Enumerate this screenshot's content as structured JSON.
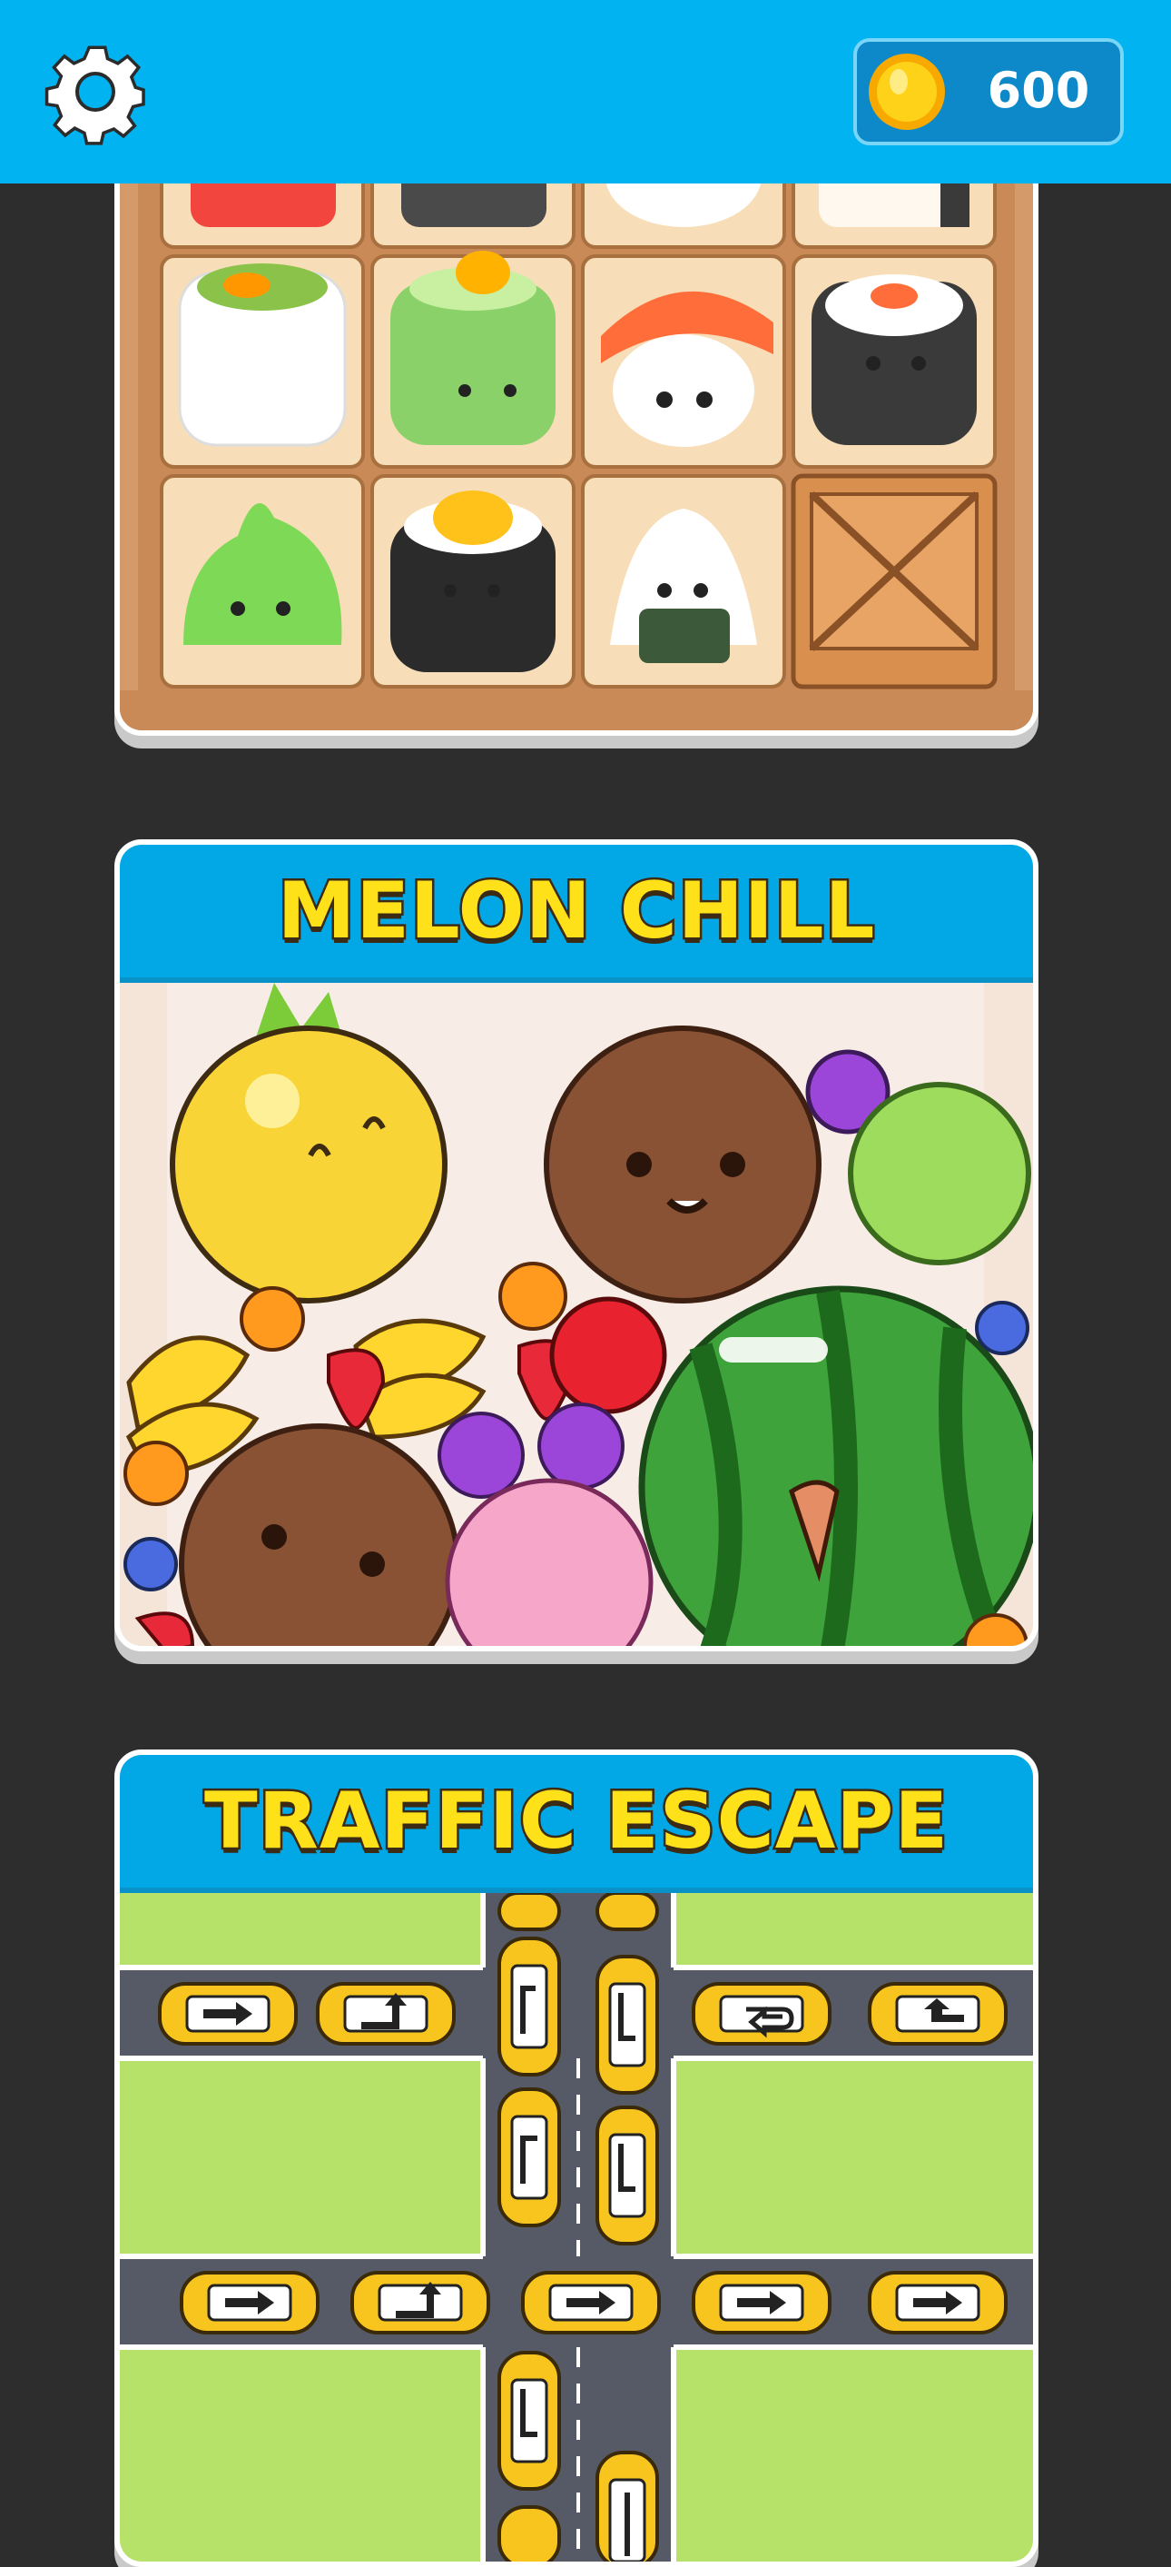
{
  "header": {
    "settings_icon": "gear-icon",
    "coin_icon": "gold-coin-icon",
    "coins": "600",
    "colors": {
      "bar": "#02b3f2",
      "coin_panel": "#0d88c8"
    }
  },
  "games": [
    {
      "title": "",
      "tiles": [
        "red-sushi",
        "black-sushi",
        "shrimp-nigiri",
        "salmon-roll",
        "veggie-roll",
        "cucumber-roll",
        "salmon-nigiri",
        "maki-roll",
        "wasabi",
        "egg-roll",
        "onigiri",
        "wooden-crate"
      ]
    },
    {
      "title": "MELON CHILL",
      "fruits": [
        "pineapple",
        "coconut",
        "grape",
        "melon",
        "banana",
        "persimmon",
        "strawberry",
        "apple",
        "watermelon",
        "peach",
        "blueberry"
      ]
    },
    {
      "title": "TRAFFIC ESCAPE",
      "cars": [
        "yellow-car",
        "arrow-right",
        "arrow-turn-up",
        "arrow-turn-left",
        "arrow-up",
        "arrow-u-turn"
      ]
    }
  ]
}
